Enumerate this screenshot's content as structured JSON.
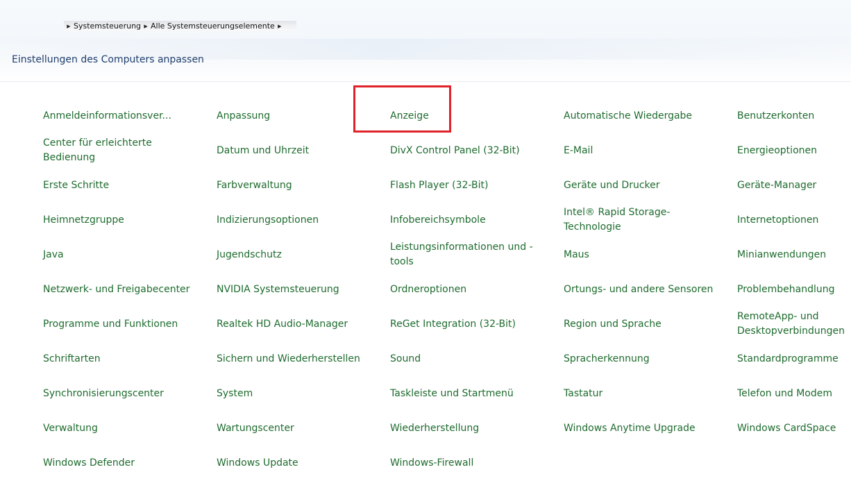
{
  "breadcrumb": {
    "items": [
      "Systemsteuerung",
      "Alle Systemsteuerungselemente"
    ]
  },
  "page_title": "Einstellungen des Computers anpassen",
  "colors": {
    "link": "#1e6b2e",
    "title": "#1e3d6b",
    "highlight": "#e0222a"
  },
  "highlighted_item": "Anzeige",
  "items": [
    "Anmeldeinformationsver...",
    "Anpassung",
    "Anzeige",
    "Automatische Wiedergabe",
    "Benutzerkonten",
    "Center für erleichterte Bedienung",
    "Datum und Uhrzeit",
    "DivX Control Panel (32-Bit)",
    "E-Mail",
    "Energieoptionen",
    "Erste Schritte",
    "Farbverwaltung",
    "Flash Player (32-Bit)",
    "Geräte und Drucker",
    "Geräte-Manager",
    "Heimnetzgruppe",
    "Indizierungsoptionen",
    "Infobereichsymbole",
    "Intel® Rapid Storage-Technologie",
    "Internetoptionen",
    "Java",
    "Jugendschutz",
    "Leistungsinformationen und -tools",
    "Maus",
    "Minianwendungen",
    "Netzwerk- und Freigabecenter",
    "NVIDIA Systemsteuerung",
    "Ordneroptionen",
    "Ortungs- und andere Sensoren",
    "Problembehandlung",
    "Programme und Funktionen",
    "Realtek HD Audio-Manager",
    "ReGet Integration (32-Bit)",
    "Region und Sprache",
    "RemoteApp- und Desktopverbindungen",
    "Schriftarten",
    "Sichern und Wiederherstellen",
    "Sound",
    "Spracherkennung",
    "Standardprogramme",
    "Synchronisierungscenter",
    "System",
    "Taskleiste und Startmenü",
    "Tastatur",
    "Telefon und Modem",
    "Verwaltung",
    "Wartungscenter",
    "Wiederherstellung",
    "Windows Anytime Upgrade",
    "Windows CardSpace",
    "Windows Defender",
    "Windows Update",
    "Windows-Firewall"
  ]
}
